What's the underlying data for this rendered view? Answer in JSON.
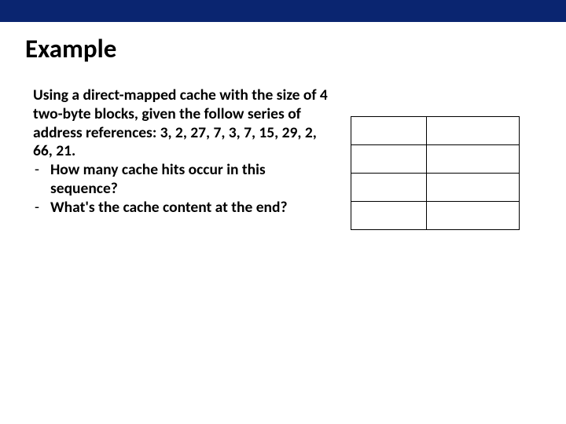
{
  "title": "Example",
  "body": {
    "intro": "Using a direct-mapped cache with the size of 4 two-byte blocks, given the follow series of address references: 3, 2, 27, 7, 3, 7, 15, 29, 2, 66, 21.",
    "bullet_marker": "-",
    "bullets": [
      "How many cache hits occur in this sequence?",
      "What's the cache content at the end?"
    ]
  },
  "cache_table": {
    "rows": 4,
    "cols": 2,
    "cells": [
      [
        "",
        ""
      ],
      [
        "",
        ""
      ],
      [
        "",
        ""
      ],
      [
        "",
        ""
      ]
    ]
  }
}
